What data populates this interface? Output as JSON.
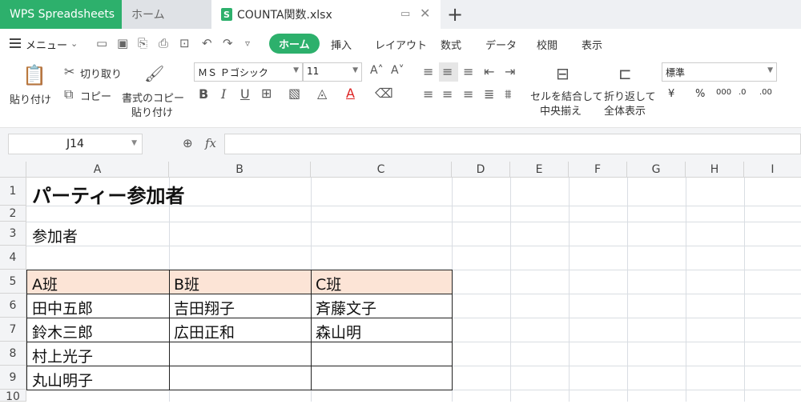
{
  "tabs": {
    "app": "WPS Spreadsheets",
    "home": "ホーム",
    "file": "COUNTA関数.xlsx",
    "file_icon": "S"
  },
  "menu": {
    "label": "メニュー",
    "ribbon_tabs": [
      "ホーム",
      "挿入",
      "レイアウト",
      "数式",
      "データ",
      "校閲",
      "表示"
    ]
  },
  "ribbon": {
    "paste": "貼り付け",
    "cut": "切り取り",
    "copy": "コピー",
    "format_copy_1": "書式のコピー",
    "format_copy_2": "貼り付け",
    "font_name": "ＭＳ Ｐゴシック",
    "font_size": "11",
    "merge_1": "セルを結合して",
    "merge_2": "中央揃え",
    "wrap_1": "折り返して",
    "wrap_2": "全体表示",
    "number_format": "標準",
    "currency": "¥",
    "percent": "%",
    "thousands": "000",
    "dec_inc": ".0",
    "dec_dec": ".00"
  },
  "formula_bar": {
    "cell_ref": "J14",
    "fx": "fx",
    "value": ""
  },
  "sheet": {
    "columns": [
      "A",
      "B",
      "C",
      "D",
      "E",
      "F",
      "G",
      "H",
      "I"
    ],
    "rows": [
      "1",
      "2",
      "3",
      "4",
      "5",
      "6",
      "7",
      "8",
      "9",
      "10"
    ],
    "title": "パーティー参加者",
    "section": "参加者",
    "headers": [
      "A班",
      "B班",
      "C班"
    ],
    "data": [
      [
        "田中五郎",
        "吉田翔子",
        "斉藤文子"
      ],
      [
        "鈴木三郎",
        "広田正和",
        "森山明"
      ],
      [
        "村上光子",
        "",
        ""
      ],
      [
        "丸山明子",
        "",
        ""
      ]
    ],
    "header_fill": "#fce4d6"
  },
  "colors": {
    "accent": "#2db06c"
  }
}
